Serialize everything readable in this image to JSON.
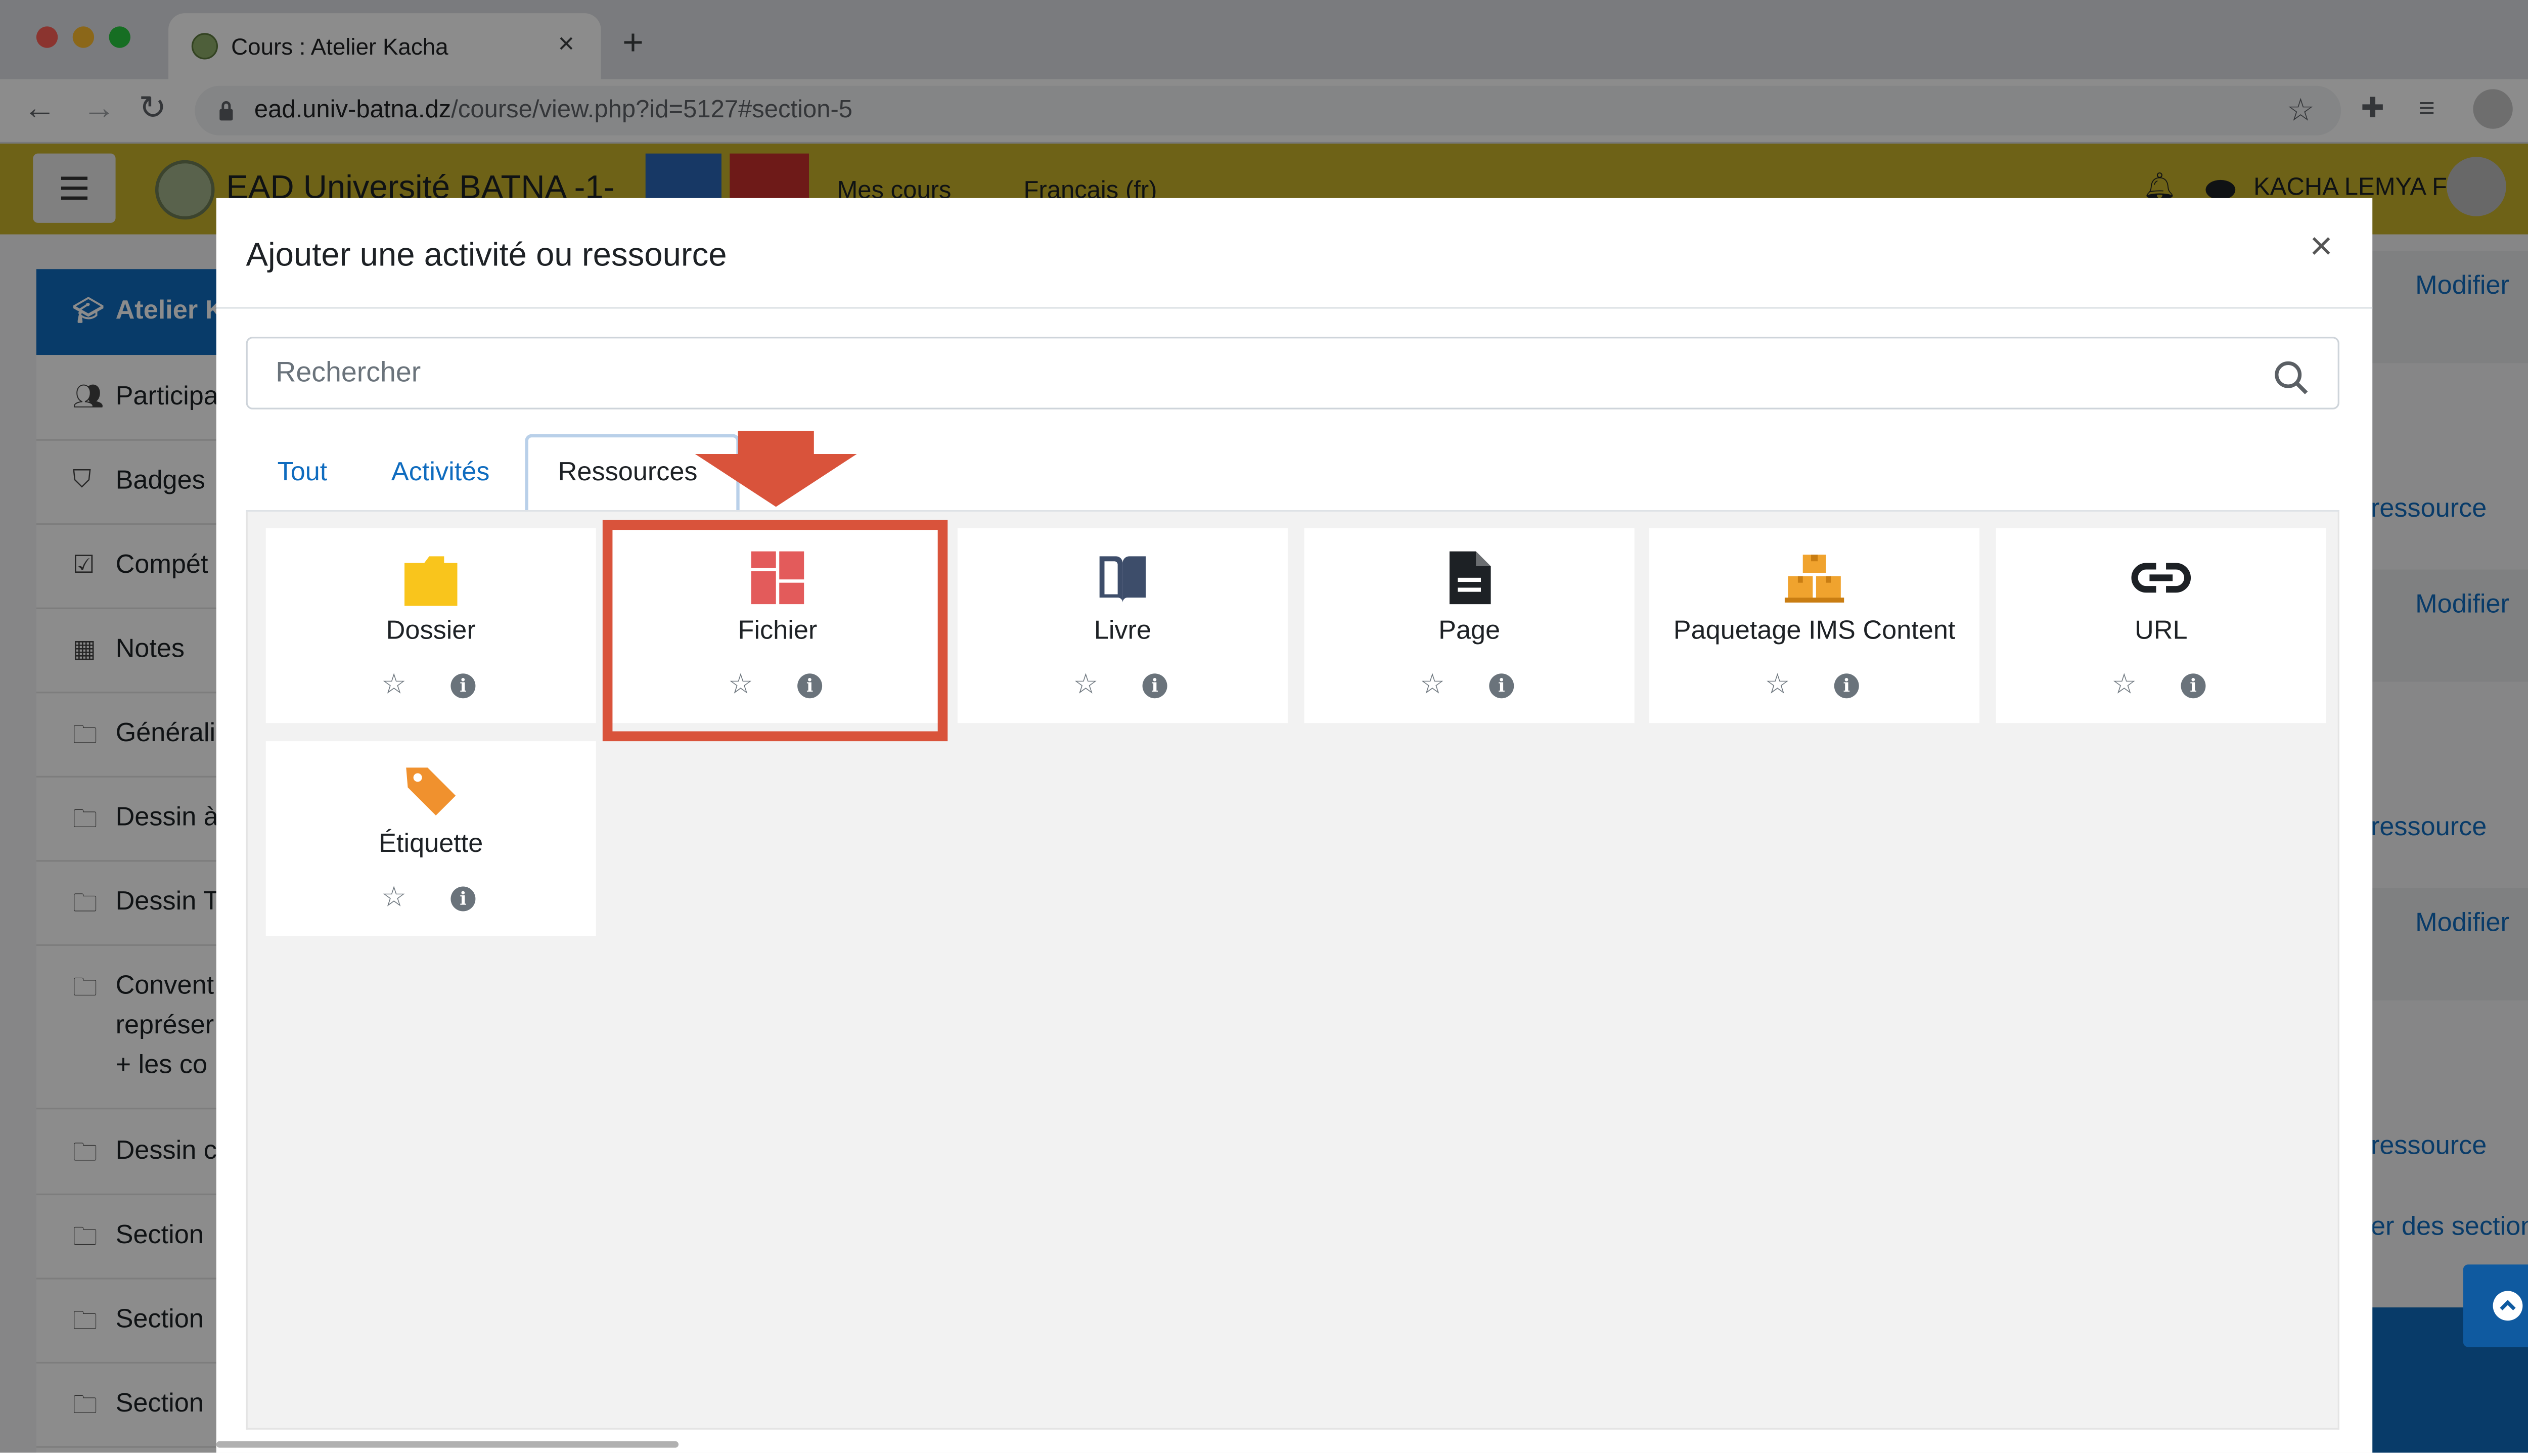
{
  "browser": {
    "tab_title": "Cours : Atelier Kacha",
    "tab_close": "×",
    "new_tab": "+",
    "url_domain": "ead.univ-batna.dz",
    "url_path": "/course/view.php?id=5127#section-5"
  },
  "moodle": {
    "site_name": "EAD Université BATNA -1-",
    "nav": [
      "Mes cours",
      "Français (fr)"
    ],
    "user_name": "KACHA LEMYA F",
    "drawer_header": "Atelier K",
    "drawer_items": [
      "Participa",
      "Badges",
      "Compét",
      "Notes",
      "Générali",
      "Dessin à",
      "Dessin T",
      "Convent",
      "Dessin c",
      "Section",
      "Section",
      "Section"
    ],
    "drawer_item_extra_lines": [
      "représer",
      "+ les co"
    ],
    "modifier_label": "Modifier",
    "right_links": [
      "ressource",
      "ressource",
      "ressource",
      "er des sections"
    ]
  },
  "modal": {
    "title": "Ajouter une activité ou ressource",
    "close": "×",
    "search_placeholder": "Rechercher",
    "tabs": [
      "Tout",
      "Activités",
      "Ressources"
    ],
    "active_tab": "Ressources",
    "items": [
      {
        "label": "Dossier",
        "icon": "folder-icon",
        "color": "#f9c51c"
      },
      {
        "label": "Fichier",
        "icon": "file-icon",
        "color": "#e35b5b"
      },
      {
        "label": "Livre",
        "icon": "book-icon",
        "color": "#3d4d6a"
      },
      {
        "label": "Page",
        "icon": "page-icon",
        "color": "#1d2125"
      },
      {
        "label": "Paquetage IMS Content",
        "icon": "ims-package-icon",
        "color": "#f0a32e"
      },
      {
        "label": "URL",
        "icon": "link-icon",
        "color": "#1d2125"
      },
      {
        "label": "Étiquette",
        "icon": "label-tag-icon",
        "color": "#f0912e"
      }
    ],
    "highlighted_item": "Fichier"
  },
  "colors": {
    "moodle_bar": "#c9b32b",
    "link_blue": "#0f6cbf",
    "annotation_red": "#d9533b"
  }
}
